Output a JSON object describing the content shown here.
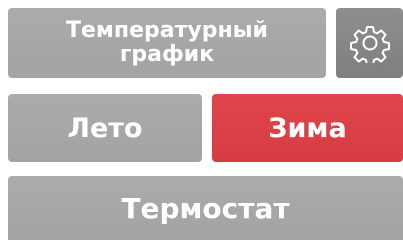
{
  "buttons": {
    "temperature_graph": {
      "line1": "Температурный",
      "line2": "график"
    },
    "summer": "Лето",
    "winter": "Зима",
    "thermostat": "Термостат",
    "settings_icon": "gear-icon"
  },
  "colors": {
    "button_gray": "#a8a8a8",
    "button_active_red": "#dc4147",
    "settings_gray": "#888888",
    "text": "#ffffff"
  },
  "state": {
    "selected_mode": "Зима"
  }
}
